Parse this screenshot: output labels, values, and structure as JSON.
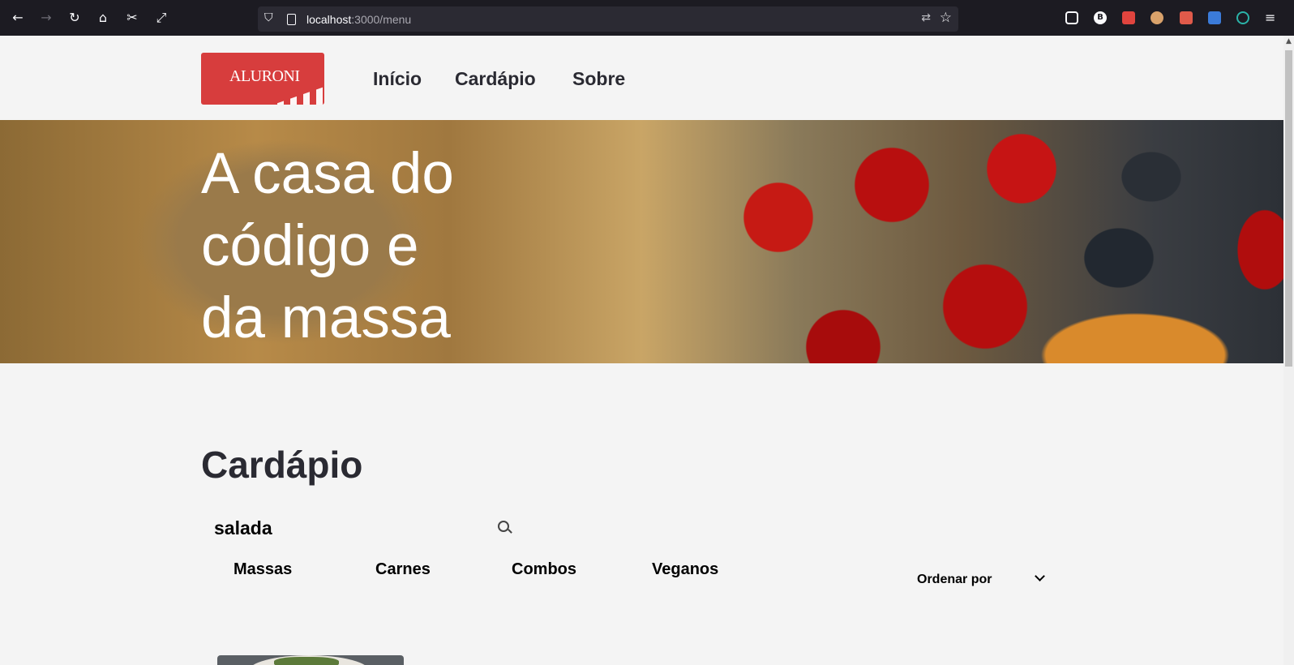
{
  "browser": {
    "url_host": "localhost",
    "url_path": ":3000/menu"
  },
  "header": {
    "logo_text": "ALURONI",
    "nav": {
      "inicio": "Início",
      "cardapio": "Cardápio",
      "sobre": "Sobre"
    }
  },
  "hero": {
    "line1": "A casa do",
    "line2": "código e",
    "line3": "da massa"
  },
  "menu": {
    "title": "Cardápio",
    "search_value": "salada",
    "filters": [
      "Massas",
      "Carnes",
      "Combos",
      "Veganos"
    ],
    "sort_label": "Ordenar por"
  },
  "colors": {
    "brand_red": "#d73d3d",
    "text_dark": "#2a2a32",
    "background": "#f4f4f4"
  }
}
